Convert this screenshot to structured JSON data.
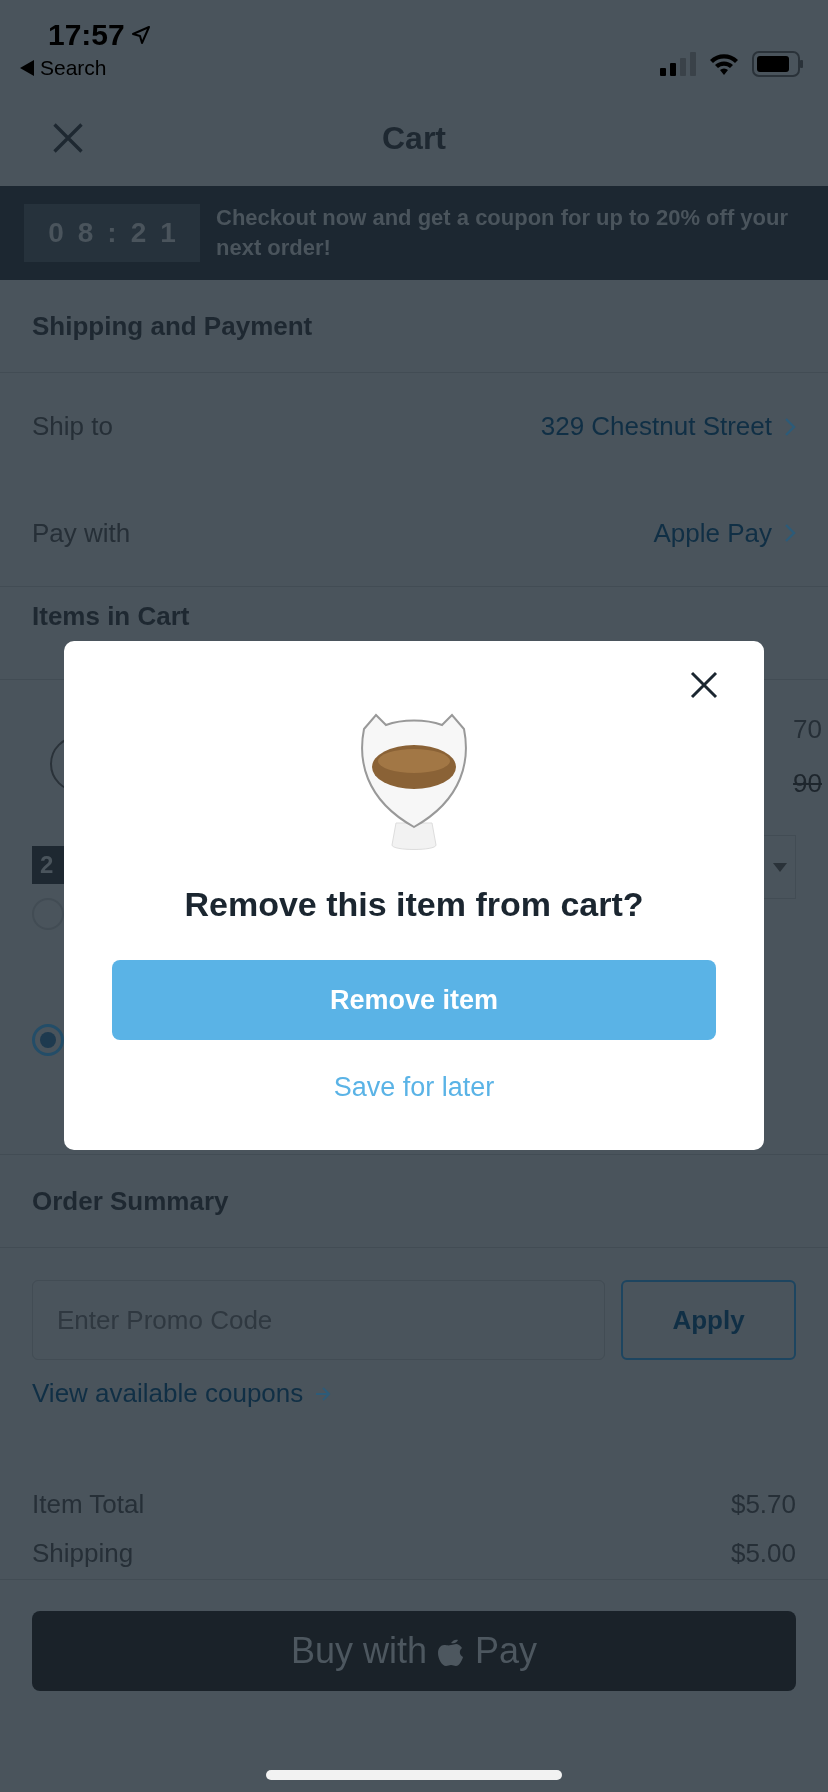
{
  "status_bar": {
    "time": "17:57",
    "back_label": "Search"
  },
  "header": {
    "title": "Cart"
  },
  "promo_banner": {
    "timer": "08:21",
    "message": "Checkout now and get a coupon for up to 20% off your next order!"
  },
  "shipping_payment": {
    "heading": "Shipping and Payment",
    "rows": [
      {
        "label": "Ship to",
        "value": "329 Chestnut Street"
      },
      {
        "label": "Pay with",
        "value": "Apple Pay"
      }
    ]
  },
  "items_in_cart": {
    "heading": "Items in Cart",
    "quantity": "2",
    "price": "70",
    "original_price": "90",
    "options": [
      {
        "selected": false
      },
      {
        "selected": true
      }
    ]
  },
  "order_summary": {
    "heading": "Order Summary",
    "promo_placeholder": "Enter Promo Code",
    "apply_label": "Apply",
    "coupons_link": "View available coupons",
    "totals": [
      {
        "label": "Item Total",
        "value": "$5.70"
      },
      {
        "label": "Shipping",
        "value": "$5.00"
      }
    ]
  },
  "buy_button": {
    "label_before": "Buy with",
    "label_after": "Pay"
  },
  "modal": {
    "title": "Remove this item from cart?",
    "primary_action": "Remove item",
    "secondary_action": "Save for later"
  }
}
